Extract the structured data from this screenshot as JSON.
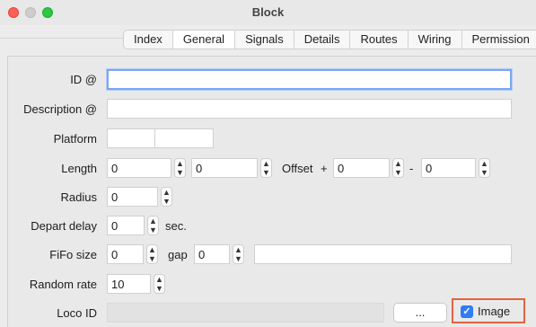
{
  "window": {
    "title": "Block"
  },
  "tabs": [
    {
      "label": "Index"
    },
    {
      "label": "General",
      "active": true
    },
    {
      "label": "Signals"
    },
    {
      "label": "Details"
    },
    {
      "label": "Routes"
    },
    {
      "label": "Wiring"
    },
    {
      "label": "Permission"
    }
  ],
  "form": {
    "id_label": "ID @",
    "id_value": "",
    "description_label": "Description @",
    "description_value": "",
    "platform_label": "Platform",
    "length_label": "Length",
    "length_value": "0",
    "length_value2": "0",
    "offset_label": "Offset",
    "offset_plus": "+",
    "offset_value": "0",
    "offset_minus": "-",
    "offset_value2": "0",
    "radius_label": "Radius",
    "radius_value": "0",
    "depart_delay_label": "Depart delay",
    "depart_delay_value": "0",
    "depart_delay_unit": "sec.",
    "fifo_label": "FiFo size",
    "fifo_value": "0",
    "gap_label": "gap",
    "gap_value": "0",
    "fifo_extra_value": "",
    "random_rate_label": "Random rate",
    "random_rate_value": "10",
    "loco_id_label": "Loco ID",
    "loco_id_value": "",
    "browse_button": "...",
    "image_checkbox_label": "Image",
    "image_checked": true
  },
  "colors": {
    "accent": "#2f7cf6",
    "focus_ring": "#7aa7f0",
    "highlight_box": "#e2643f"
  }
}
